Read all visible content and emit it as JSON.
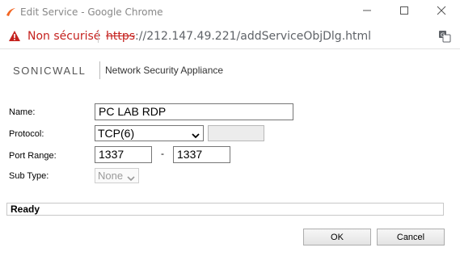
{
  "window": {
    "title": "Edit Service - Google Chrome"
  },
  "addressbar": {
    "security_label": "Non sécurisé",
    "url_scheme": "https",
    "url_rest": "://212.147.49.221/addServiceObjDlg.html"
  },
  "header": {
    "brand": "SONICWALL",
    "product": "Network Security Appliance"
  },
  "form": {
    "name_label": "Name:",
    "name_value": "PC LAB RDP",
    "protocol_label": "Protocol:",
    "protocol_value": "TCP(6)",
    "port_range_label": "Port Range:",
    "port_start": "1337",
    "port_separator": "-",
    "port_end": "1337",
    "subtype_label": "Sub Type:",
    "subtype_value": "None"
  },
  "status": {
    "text": "Ready"
  },
  "buttons": {
    "ok": "OK",
    "cancel": "Cancel"
  },
  "colors": {
    "insecure_red": "#c5221f",
    "brand_accent": "#f26522"
  }
}
